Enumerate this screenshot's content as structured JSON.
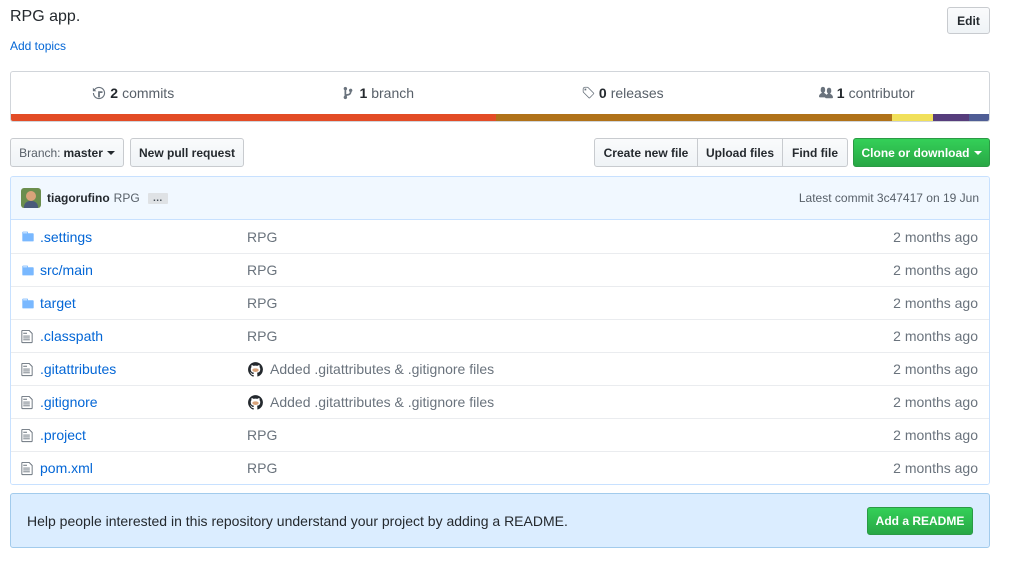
{
  "repo": {
    "description": "RPG app.",
    "add_topics": "Add topics",
    "edit_label": "Edit"
  },
  "summary": {
    "commits_count": "2",
    "commits_label": "commits",
    "branches_count": "1",
    "branches_label": "branch",
    "releases_count": "0",
    "releases_label": "releases",
    "contributors_count": "1",
    "contributors_label": "contributor",
    "language_colors": [
      "#e34c26",
      "#b07219",
      "#f1e05a",
      "#563d7c",
      "#4f5d95"
    ],
    "language_fractions": [
      0.502,
      0.41,
      0.043,
      0.037,
      0.021
    ]
  },
  "toolbar": {
    "branch_prefix": "Branch:",
    "branch_name": "master",
    "new_pr": "New pull request",
    "create_file": "Create new file",
    "upload_files": "Upload files",
    "find_file": "Find file",
    "clone": "Clone or download"
  },
  "commit": {
    "author": "tiagorufino",
    "message": "RPG",
    "ellipsis": "…",
    "latest": "Latest commit 3c47417 on 19 Jun"
  },
  "files": [
    {
      "type": "folder",
      "name": ".settings",
      "message": "RPG",
      "age": "2 months ago",
      "octocat": false
    },
    {
      "type": "folder",
      "name": "src/main",
      "message": "RPG",
      "age": "2 months ago",
      "octocat": false
    },
    {
      "type": "folder",
      "name": "target",
      "message": "RPG",
      "age": "2 months ago",
      "octocat": false
    },
    {
      "type": "file",
      "name": ".classpath",
      "message": "RPG",
      "age": "2 months ago",
      "octocat": false
    },
    {
      "type": "file",
      "name": ".gitattributes",
      "message": "Added .gitattributes & .gitignore files",
      "age": "2 months ago",
      "octocat": true
    },
    {
      "type": "file",
      "name": ".gitignore",
      "message": "Added .gitattributes & .gitignore files",
      "age": "2 months ago",
      "octocat": true
    },
    {
      "type": "file",
      "name": ".project",
      "message": "RPG",
      "age": "2 months ago",
      "octocat": false
    },
    {
      "type": "file",
      "name": "pom.xml",
      "message": "RPG",
      "age": "2 months ago",
      "octocat": false
    }
  ],
  "readme": {
    "text": "Help people interested in this repository understand your project by adding a README.",
    "button": "Add a README"
  }
}
